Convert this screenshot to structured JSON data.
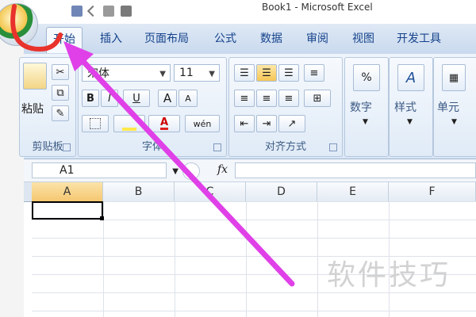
{
  "window": {
    "title": "Book1 - Microsoft Excel"
  },
  "tabs": [
    {
      "label": "开始",
      "active": true
    },
    {
      "label": "插入"
    },
    {
      "label": "页面布局"
    },
    {
      "label": "公式"
    },
    {
      "label": "数据"
    },
    {
      "label": "审阅"
    },
    {
      "label": "视图"
    },
    {
      "label": "开发工具"
    }
  ],
  "ribbon": {
    "clipboard": {
      "label": "剪贴板",
      "paste_label": "粘贴"
    },
    "font": {
      "label": "字体",
      "font_name": "宋体",
      "font_size": "11",
      "bold": "B",
      "italic": "I",
      "underline": "U",
      "grow": "A",
      "shrink": "A",
      "phonetic": "wén"
    },
    "alignment": {
      "label": "对齐方式"
    },
    "number": {
      "label": "数字",
      "percent": "%"
    },
    "styles": {
      "label": "样式"
    },
    "cells": {
      "label": "单元"
    }
  },
  "formula_bar": {
    "name_box": "A1",
    "fx": "fx"
  },
  "grid": {
    "columns": [
      "A",
      "B",
      "C",
      "D",
      "E",
      "F"
    ],
    "active_cell": "A1"
  },
  "watermark": "软件技巧",
  "colors": {
    "accent": "#15428b",
    "arrow": "#e040e8",
    "circle": "#e8322b"
  }
}
